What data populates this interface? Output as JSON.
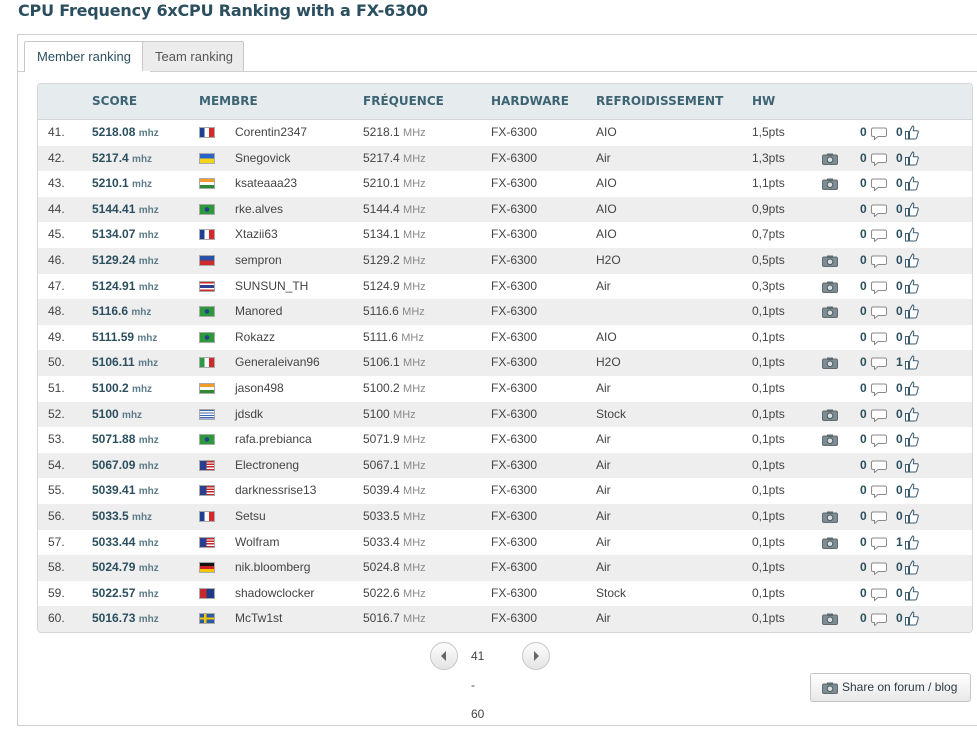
{
  "page": {
    "title": "CPU Frequency 6xCPU Ranking with a FX-6300"
  },
  "tabs": [
    {
      "label": "Member ranking",
      "active": true
    },
    {
      "label": "Team ranking",
      "active": false
    }
  ],
  "table": {
    "columns": {
      "score": "SCORE",
      "membre": "MEMBRE",
      "frequence": "FRÉQUENCE",
      "hardware": "HARDWARE",
      "refroidissement": "REFROIDISSEMENT",
      "hw": "HW"
    },
    "score_unit": "mhz",
    "freq_unit": "MHz",
    "rows": [
      {
        "rank": "41.",
        "score": "5218.08",
        "flag": "fr",
        "user": "Corentin2347",
        "freq": "5218.1",
        "hardware": "FX-6300",
        "cooling": "AIO",
        "pts": "1,5pts",
        "photo": false,
        "comments": "0",
        "likes": "0"
      },
      {
        "rank": "42.",
        "score": "5217.4",
        "flag": "ua",
        "user": "Snegovick",
        "freq": "5217.4",
        "hardware": "FX-6300",
        "cooling": "Air",
        "pts": "1,3pts",
        "photo": true,
        "comments": "0",
        "likes": "0"
      },
      {
        "rank": "43.",
        "score": "5210.1",
        "flag": "in",
        "user": "ksateaaa23",
        "freq": "5210.1",
        "hardware": "FX-6300",
        "cooling": "AIO",
        "pts": "1,1pts",
        "photo": true,
        "comments": "0",
        "likes": "0"
      },
      {
        "rank": "44.",
        "score": "5144.41",
        "flag": "br",
        "user": "rke.alves",
        "freq": "5144.4",
        "hardware": "FX-6300",
        "cooling": "AIO",
        "pts": "0,9pts",
        "photo": false,
        "comments": "0",
        "likes": "0"
      },
      {
        "rank": "45.",
        "score": "5134.07",
        "flag": "fr",
        "user": "Xtazii63",
        "freq": "5134.1",
        "hardware": "FX-6300",
        "cooling": "AIO",
        "pts": "0,7pts",
        "photo": false,
        "comments": "0",
        "likes": "0"
      },
      {
        "rank": "46.",
        "score": "5129.24",
        "flag": "ph",
        "user": "sempron",
        "freq": "5129.2",
        "hardware": "FX-6300",
        "cooling": "H2O",
        "pts": "0,5pts",
        "photo": true,
        "comments": "0",
        "likes": "0"
      },
      {
        "rank": "47.",
        "score": "5124.91",
        "flag": "th",
        "user": "SUNSUN_TH",
        "freq": "5124.9",
        "hardware": "FX-6300",
        "cooling": "Air",
        "pts": "0,3pts",
        "photo": true,
        "comments": "0",
        "likes": "0"
      },
      {
        "rank": "48.",
        "score": "5116.6",
        "flag": "br",
        "user": "Manored",
        "freq": "5116.6",
        "hardware": "FX-6300",
        "cooling": "",
        "pts": "0,1pts",
        "photo": true,
        "comments": "0",
        "likes": "0"
      },
      {
        "rank": "49.",
        "score": "5111.59",
        "flag": "br",
        "user": "Rokazz",
        "freq": "5111.6",
        "hardware": "FX-6300",
        "cooling": "AIO",
        "pts": "0,1pts",
        "photo": false,
        "comments": "0",
        "likes": "0"
      },
      {
        "rank": "50.",
        "score": "5106.11",
        "flag": "it",
        "user": "Generaleivan96",
        "freq": "5106.1",
        "hardware": "FX-6300",
        "cooling": "H2O",
        "pts": "0,1pts",
        "photo": true,
        "comments": "0",
        "likes": "1"
      },
      {
        "rank": "51.",
        "score": "5100.2",
        "flag": "in",
        "user": "jason498",
        "freq": "5100.2",
        "hardware": "FX-6300",
        "cooling": "Air",
        "pts": "0,1pts",
        "photo": false,
        "comments": "0",
        "likes": "0"
      },
      {
        "rank": "52.",
        "score": "5100",
        "flag": "gr",
        "user": "jdsdk",
        "freq": "5100",
        "hardware": "FX-6300",
        "cooling": "Stock",
        "pts": "0,1pts",
        "photo": true,
        "comments": "0",
        "likes": "0"
      },
      {
        "rank": "53.",
        "score": "5071.88",
        "flag": "br",
        "user": "rafa.prebianca",
        "freq": "5071.9",
        "hardware": "FX-6300",
        "cooling": "Air",
        "pts": "0,1pts",
        "photo": true,
        "comments": "0",
        "likes": "0"
      },
      {
        "rank": "54.",
        "score": "5067.09",
        "flag": "us",
        "user": "Electroneng",
        "freq": "5067.1",
        "hardware": "FX-6300",
        "cooling": "Air",
        "pts": "0,1pts",
        "photo": false,
        "comments": "0",
        "likes": "0"
      },
      {
        "rank": "55.",
        "score": "5039.41",
        "flag": "us",
        "user": "darknessrise13",
        "freq": "5039.4",
        "hardware": "FX-6300",
        "cooling": "Air",
        "pts": "0,1pts",
        "photo": false,
        "comments": "0",
        "likes": "0"
      },
      {
        "rank": "56.",
        "score": "5033.5",
        "flag": "fr",
        "user": "Setsu",
        "freq": "5033.5",
        "hardware": "FX-6300",
        "cooling": "Air",
        "pts": "0,1pts",
        "photo": true,
        "comments": "0",
        "likes": "0"
      },
      {
        "rank": "57.",
        "score": "5033.44",
        "flag": "us",
        "user": "Wolfram",
        "freq": "5033.4",
        "hardware": "FX-6300",
        "cooling": "Air",
        "pts": "0,1pts",
        "photo": true,
        "comments": "0",
        "likes": "1"
      },
      {
        "rank": "58.",
        "score": "5024.79",
        "flag": "de",
        "user": "nik.bloomberg",
        "freq": "5024.8",
        "hardware": "FX-6300",
        "cooling": "Air",
        "pts": "0,1pts",
        "photo": false,
        "comments": "0",
        "likes": "0"
      },
      {
        "rank": "59.",
        "score": "5022.57",
        "flag": "au",
        "user": "shadowclocker",
        "freq": "5022.6",
        "hardware": "FX-6300",
        "cooling": "Stock",
        "pts": "0,1pts",
        "photo": false,
        "comments": "0",
        "likes": "0"
      },
      {
        "rank": "60.",
        "score": "5016.73",
        "flag": "se",
        "user": "McTw1st",
        "freq": "5016.7",
        "hardware": "FX-6300",
        "cooling": "Air",
        "pts": "0,1pts",
        "photo": true,
        "comments": "0",
        "likes": "0"
      }
    ]
  },
  "pagination": {
    "range": "41 - 60"
  },
  "share": {
    "label": "Share on forum / blog"
  },
  "icons": {
    "photo": "camera-icon",
    "comments": "comment-bubble-icon",
    "likes": "thumbs-up-icon"
  },
  "colors": {
    "title": "#2b4f5e",
    "header_bg": "#e6ecee",
    "alt_row": "#eeeeee"
  }
}
